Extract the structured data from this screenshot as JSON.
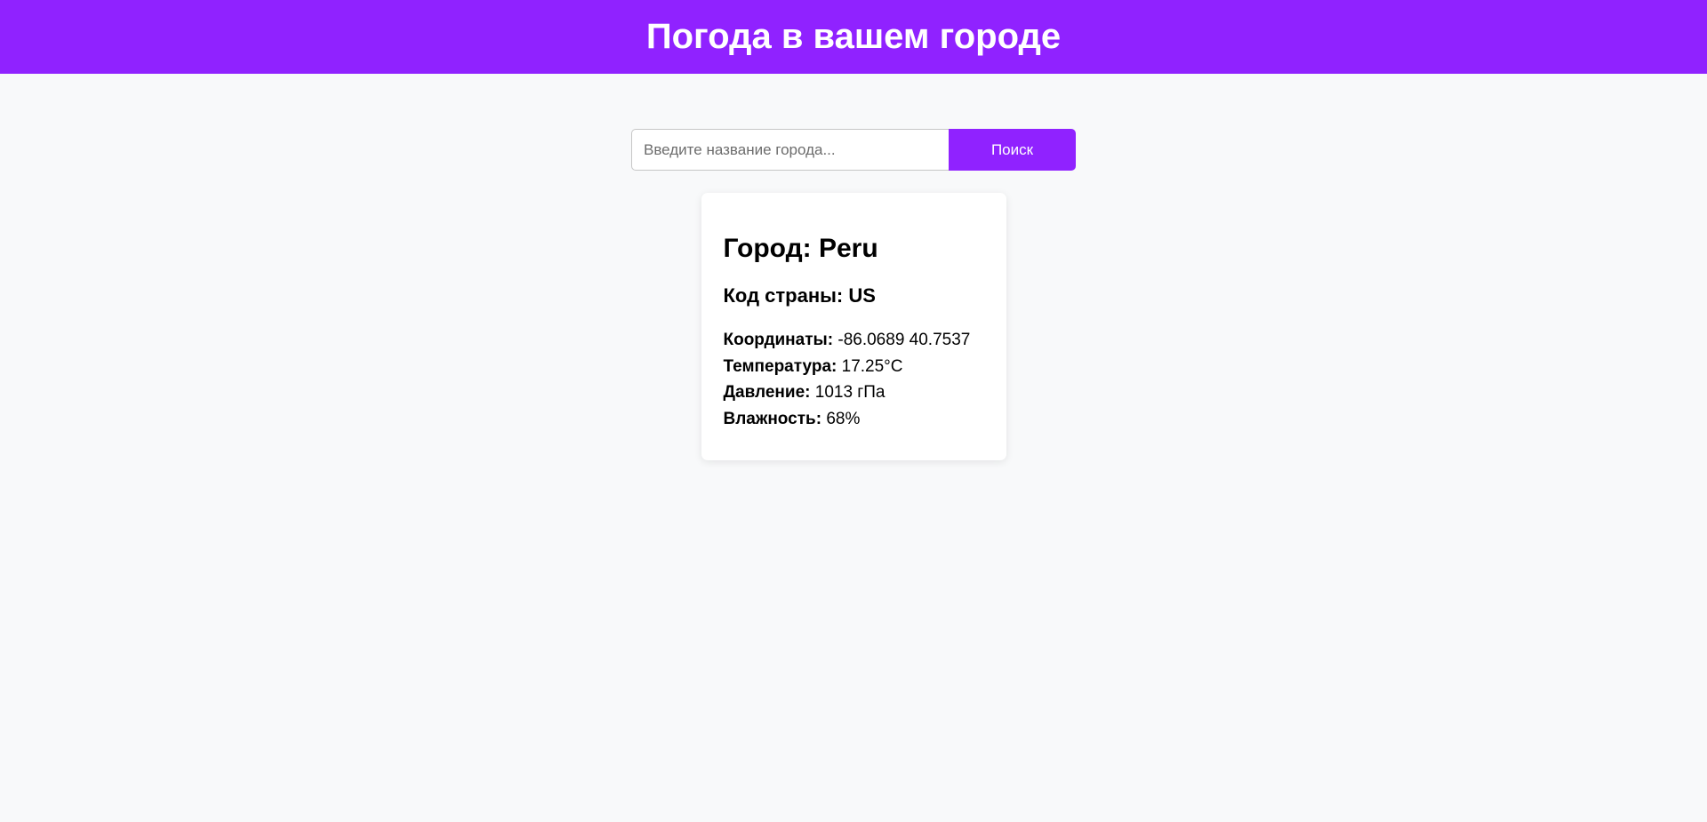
{
  "header": {
    "title": "Погода в вашем городе"
  },
  "search": {
    "placeholder": "Введите название города...",
    "value": "",
    "button_label": "Поиск"
  },
  "weather": {
    "city_label": "Город:",
    "city": "Peru",
    "country_label": "Код страны:",
    "country": "US",
    "rows": [
      {
        "label": "Координаты:",
        "value": "-86.0689 40.7537"
      },
      {
        "label": "Температура:",
        "value": "17.25°C"
      },
      {
        "label": "Давление:",
        "value": "1013 гПа"
      },
      {
        "label": "Влажность:",
        "value": "68%"
      }
    ]
  },
  "colors": {
    "accent": "#9022ff",
    "background": "#f8f9fa",
    "card": "#ffffff"
  }
}
